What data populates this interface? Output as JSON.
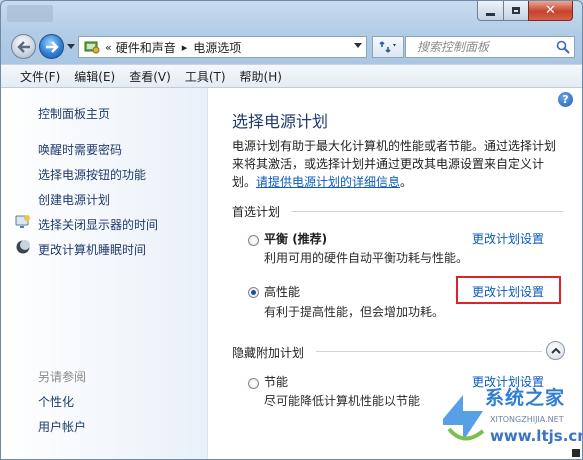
{
  "address": {
    "crumb_marker": "«",
    "path": [
      "硬件和声音",
      "电源选项"
    ],
    "separator": "▸"
  },
  "search": {
    "placeholder": "搜索控制面板"
  },
  "menu": [
    "文件(F)",
    "编辑(E)",
    "查看(V)",
    "工具(T)",
    "帮助(H)"
  ],
  "sidebar": {
    "home": "控制面板主页",
    "tasks": [
      "唤醒时需要密码",
      "选择电源按钮的功能",
      "创建电源计划",
      "选择关闭显示器的时间",
      "更改计算机睡眠时间"
    ],
    "see_also_title": "另请参阅",
    "see_also": [
      "个性化",
      "用户帐户"
    ]
  },
  "main": {
    "title": "选择电源计划",
    "description": "电源计划有助于最大化计算机的性能或者节能。通过选择计划来将其激活，或选择计划并通过更改其电源设置来自定义计划。",
    "details_link": "请提供电源计划的详细信息",
    "period": "。",
    "preferred_section": "首选计划",
    "hidden_section": "隐藏附加计划",
    "plans": [
      {
        "name": "平衡",
        "tag": " (推荐)",
        "desc": "利用可用的硬件自动平衡功耗与性能。",
        "link": "更改计划设置",
        "selected": false
      },
      {
        "name": "高性能",
        "tag": "",
        "desc": "有利于提高性能，但会增加功耗。",
        "link": "更改计划设置",
        "selected": true
      },
      {
        "name": "节能",
        "tag": "",
        "desc": "尽可能降低计算机性能以节能",
        "link": "更改计划设置",
        "selected": false
      }
    ]
  },
  "watermark": {
    "main": "系统之家",
    "sub": "XITONGZHIJIA.NET",
    "url": "www.ltjs.cn"
  },
  "colors": {
    "link": "#0b5bbd",
    "title": "#1e3a6e",
    "highlight_box": "#d9242b",
    "close_button": "#c7432a"
  }
}
